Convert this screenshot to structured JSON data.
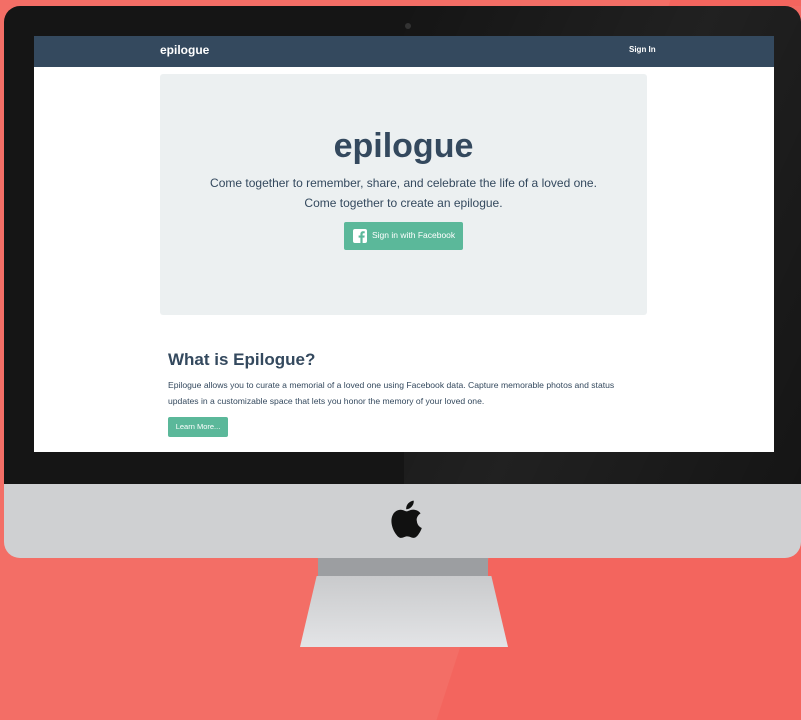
{
  "navbar": {
    "brand": "epilogue",
    "signin_label": "Sign In"
  },
  "hero": {
    "title": "epilogue",
    "line1": "Come together to remember, share, and celebrate the life of a loved one.",
    "line2": "Come together to create an epilogue.",
    "facebook_button_label": "Sign in with Facebook"
  },
  "about": {
    "title": "What is Epilogue?",
    "body": "Epilogue allows you to curate a memorial of a loved one using Facebook data. Capture memorable photos and status updates in a customizable space that lets you honor the memory of your loved one.",
    "learn_more_label": "Learn More..."
  },
  "colors": {
    "navbar": "#34495e",
    "accent_green": "#5bb89a",
    "hero_bg": "#ecf0f1",
    "page_bg": "#f36e66"
  },
  "icons": {
    "facebook": "facebook-icon",
    "device_logo": "apple-logo"
  }
}
